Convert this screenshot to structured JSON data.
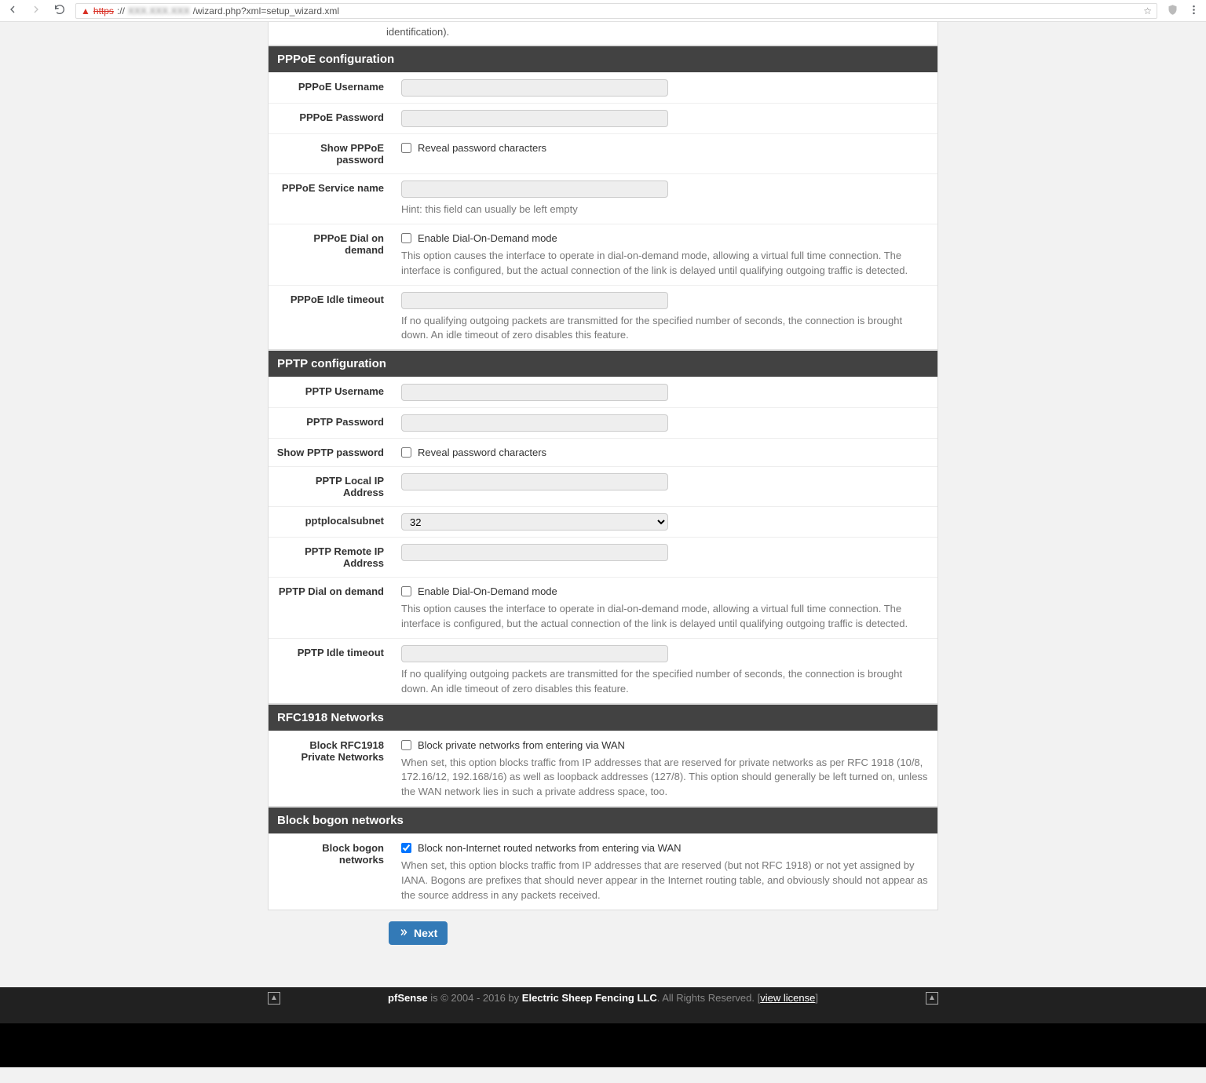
{
  "url": {
    "protocol_crossed": "https",
    "host_blurred": "XXX.XXX.XXX",
    "path": "/wizard.php?xml=setup_wizard.xml"
  },
  "partial": "identification).",
  "pppoe": {
    "heading": "PPPoE configuration",
    "username": "PPPoE Username",
    "password": "PPPoE Password",
    "show_pw_label": "Show PPPoE password",
    "show_pw_check": "Reveal password characters",
    "service_label": "PPPoE Service name",
    "service_hint": "Hint: this field can usually be left empty",
    "dial_label": "PPPoE Dial on demand",
    "dial_check": "Enable Dial-On-Demand mode",
    "dial_help": "This option causes the interface to operate in dial-on-demand mode, allowing a virtual full time connection. The interface is configured, but the actual connection of the link is delayed until qualifying outgoing traffic is detected.",
    "idle_label": "PPPoE Idle timeout",
    "idle_help": "If no qualifying outgoing packets are transmitted for the specified number of seconds, the connection is brought down. An idle timeout of zero disables this feature."
  },
  "pptp": {
    "heading": "PPTP configuration",
    "username": "PPTP Username",
    "password": "PPTP Password",
    "show_pw_label": "Show PPTP password",
    "show_pw_check": "Reveal password characters",
    "local_ip_label": "PPTP Local IP Address",
    "subnet_label": "pptplocalsubnet",
    "subnet_value": "32",
    "remote_ip_label": "PPTP Remote IP Address",
    "dial_label": "PPTP Dial on demand",
    "dial_check": "Enable Dial-On-Demand mode",
    "dial_help": "This option causes the interface to operate in dial-on-demand mode, allowing a virtual full time connection. The interface is configured, but the actual connection of the link is delayed until qualifying outgoing traffic is detected.",
    "idle_label": "PPTP Idle timeout",
    "idle_help": "If no qualifying outgoing packets are transmitted for the specified number of seconds, the connection is brought down. An idle timeout of zero disables this feature."
  },
  "rfc": {
    "heading": "RFC1918 Networks",
    "label": "Block RFC1918 Private Networks",
    "check": "Block private networks from entering via WAN",
    "help": "When set, this option blocks traffic from IP addresses that are reserved for private networks as per RFC 1918 (10/8, 172.16/12, 192.168/16) as well as loopback addresses (127/8). This option should generally be left turned on, unless the WAN network lies in such a private address space, too."
  },
  "bogon": {
    "heading": "Block bogon networks",
    "label": "Block bogon networks",
    "check": "Block non-Internet routed networks from entering via WAN",
    "help": "When set, this option blocks traffic from IP addresses that are reserved (but not RFC 1918) or not yet assigned by IANA. Bogons are prefixes that should never appear in the Internet routing table, and obviously should not appear as the source address in any packets received."
  },
  "next_btn": "Next",
  "footer": {
    "app": "pfSense",
    "mid": " is © 2004 - 2016 by ",
    "company": "Electric Sheep Fencing LLC",
    "rights": ". All Rights Reserved. [",
    "link": "view license",
    "end": "]"
  }
}
